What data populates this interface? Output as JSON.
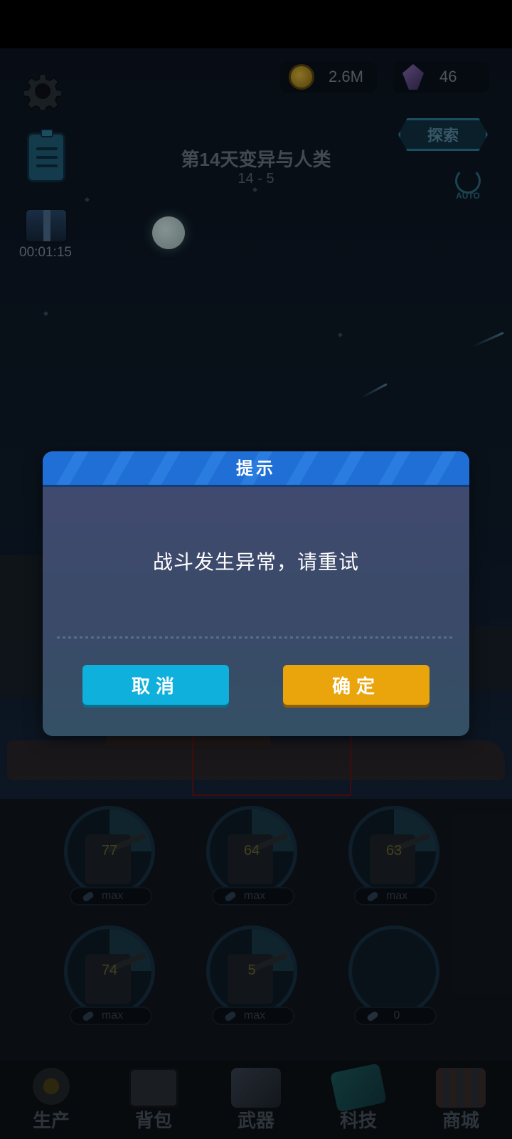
{
  "currency": {
    "coins": "2.6M",
    "gems": "46"
  },
  "hud": {
    "chest_timer": "00:01:15",
    "stage_title": "第14天变异与人类",
    "stage_level": "14 - 5",
    "explore_label": "探索",
    "auto_label": "AUTO"
  },
  "turrets": [
    {
      "level": "77",
      "capacity": "max"
    },
    {
      "level": "64",
      "capacity": "max"
    },
    {
      "level": "63",
      "capacity": "max"
    },
    {
      "level": "74",
      "capacity": "max"
    },
    {
      "level": "5",
      "capacity": "max"
    },
    {
      "level": "",
      "capacity": "0"
    }
  ],
  "nav": [
    {
      "label": "生产",
      "icon": "production-gear-icon"
    },
    {
      "label": "背包",
      "icon": "backpack-icon"
    },
    {
      "label": "武器",
      "icon": "weapon-icon"
    },
    {
      "label": "科技",
      "icon": "tech-icon"
    },
    {
      "label": "商城",
      "icon": "shop-icon"
    }
  ],
  "dialog": {
    "title": "提示",
    "message": "战斗发生异常，请重试",
    "cancel_label": "取消",
    "confirm_label": "确定"
  },
  "colors": {
    "dialog_header": "#1f6fd6",
    "cancel_button": "#10b0dc",
    "confirm_button": "#eaa50c"
  }
}
